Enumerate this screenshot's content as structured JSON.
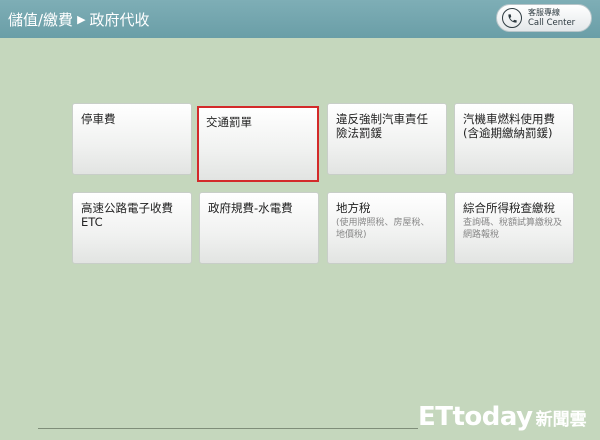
{
  "breadcrumb": {
    "section": "儲值/繳費",
    "separator_icon": "triangle-right",
    "page": "政府代收"
  },
  "call_center": {
    "label_cn": "客服專線",
    "label_en": "Call Center",
    "icon": "phone-icon"
  },
  "tiles": [
    {
      "title": "停車費",
      "subtitle": ""
    },
    {
      "title": "交通罰單",
      "subtitle": "",
      "selected": true,
      "highlight_color": "#d32a2a"
    },
    {
      "title": "違反強制汽車責任險法罰鍰",
      "subtitle": ""
    },
    {
      "title": "汽機車燃料使用費(含逾期繳納罰鍰)",
      "subtitle": ""
    },
    {
      "title": "高速公路電子收費ETC",
      "subtitle": ""
    },
    {
      "title": "政府規費-水電費",
      "subtitle": ""
    },
    {
      "title": "地方稅",
      "subtitle": "(使用牌照稅、房屋稅、地價稅)"
    },
    {
      "title": "綜合所得稅查繳稅",
      "subtitle": "查詢碼、稅額試算繳稅及網路報稅"
    }
  ],
  "watermark": {
    "brand": "ETtoday",
    "suffix": "新聞雲"
  },
  "colors": {
    "header": "#6fa3ac",
    "background": "#c5d7bd",
    "selection": "#d32a2a"
  }
}
